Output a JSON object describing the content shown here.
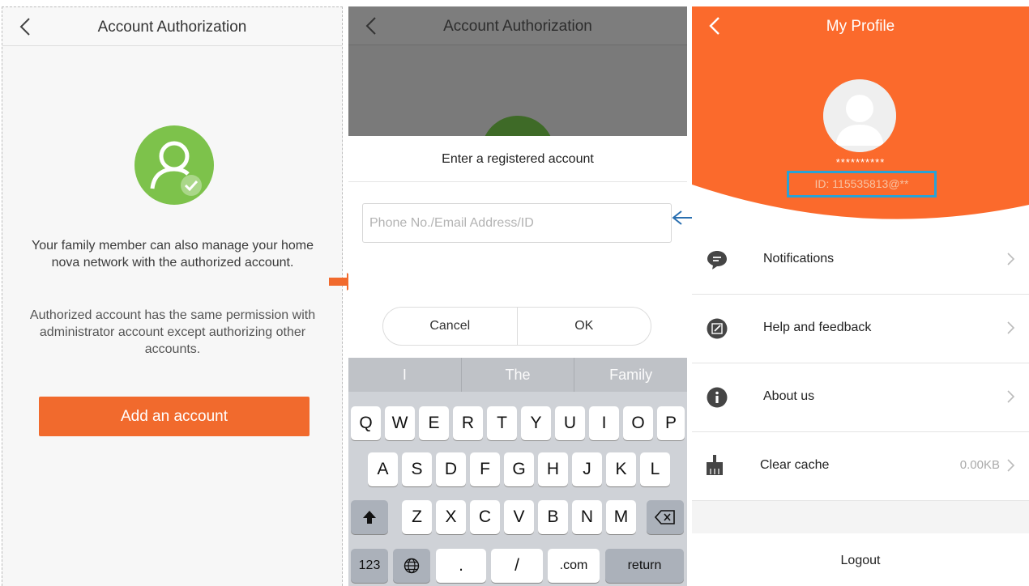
{
  "colors": {
    "accent": "#f16a2d",
    "green": "#7dc24b",
    "highlight": "#29a2d6"
  },
  "panel1": {
    "title": "Account Authorization",
    "desc1": "Your family member can also manage your home nova network with the authorized account.",
    "desc2": "Authorized account has the same permission with administrator account except authorizing other accounts.",
    "add_button": "Add an account"
  },
  "panel2": {
    "title": "Account Authorization",
    "dialog_title": "Enter a registered account",
    "input_placeholder": "Phone No./Email Address/ID",
    "cancel": "Cancel",
    "ok": "OK",
    "predictions": [
      "I",
      "The",
      "Family"
    ],
    "keys_row1": [
      "Q",
      "W",
      "E",
      "R",
      "T",
      "Y",
      "U",
      "I",
      "O",
      "P"
    ],
    "keys_row2": [
      "A",
      "S",
      "D",
      "F",
      "G",
      "H",
      "J",
      "K",
      "L"
    ],
    "keys_row3": [
      "Z",
      "X",
      "C",
      "V",
      "B",
      "N",
      "M"
    ],
    "key_123": "123",
    "key_dot": ".",
    "key_slash": "/",
    "key_com": ".com",
    "key_return": "return"
  },
  "panel3": {
    "title": "My Profile",
    "username": "**********",
    "user_id": "ID: 115535813@**",
    "rows": [
      {
        "label": "Notifications",
        "icon": "chat-bubble-icon"
      },
      {
        "label": "Help and feedback",
        "icon": "edit-icon"
      },
      {
        "label": "About us",
        "icon": "info-icon"
      },
      {
        "label": "Clear cache",
        "icon": "broom-icon",
        "value": "0.00KB"
      }
    ],
    "logout": "Logout"
  }
}
